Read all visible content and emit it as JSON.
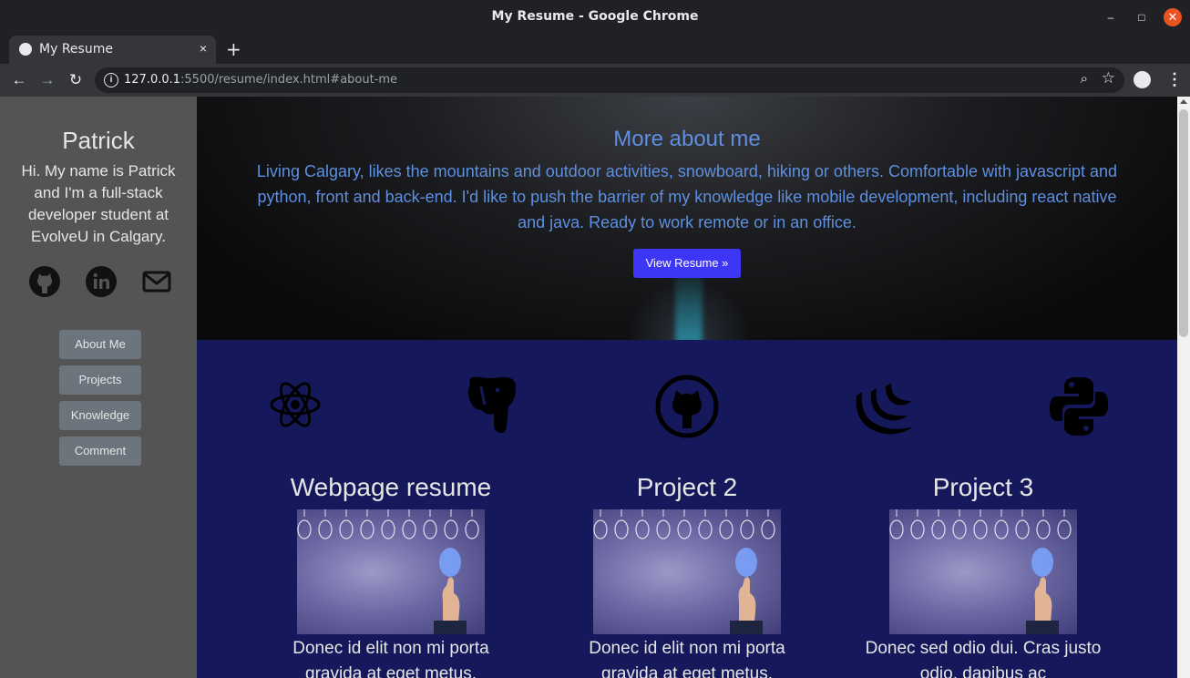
{
  "window": {
    "title": "My Resume - Google Chrome"
  },
  "tab": {
    "title": "My Resume",
    "close": "×",
    "new_tab": "+"
  },
  "address": {
    "host": "127.0.0.1",
    "rest": ":5500/resume/index.html#about-me"
  },
  "icons": {
    "back": "arrow-left-icon",
    "forward": "arrow-right-icon",
    "reload": "reload-icon",
    "info": "info-icon",
    "zoom": "zoom-icon",
    "star": "star-icon",
    "profile": "profile-icon",
    "menu": "kebab-menu-icon"
  },
  "sidebar": {
    "name": "Patrick",
    "intro": "Hi. My name is Patrick and I'm a full-stack developer student at EvolveU in Calgary.",
    "social": [
      "github-icon",
      "linkedin-icon",
      "mail-icon"
    ],
    "nav": [
      "About Me",
      "Projects",
      "Knowledge",
      "Comment"
    ]
  },
  "hero": {
    "title": "More about me",
    "text": "Living Calgary, likes the mountains and outdoor activities, snowboard, hiking or others. Comfortable with javascript and python, front and back-end. I'd like to push the barrier of my knowledge like mobile development, including react native and java. Ready to work remote or in an office.",
    "button": "View Resume »"
  },
  "skills": [
    "react-icon",
    "postgresql-icon",
    "github-icon",
    "jquery-icon",
    "python-icon"
  ],
  "projects": [
    {
      "title": "Webpage resume",
      "desc": "Donec id elit non mi porta gravida at eget metus."
    },
    {
      "title": "Project 2",
      "desc": "Donec id elit non mi porta gravida at eget metus."
    },
    {
      "title": "Project 3",
      "desc": "Donec sed odio dui. Cras justo odio, dapibus ac"
    }
  ],
  "colors": {
    "accent": "#5e8fe0",
    "button": "#3d36f4",
    "sidebar": "#545454",
    "section": "#15185a"
  }
}
